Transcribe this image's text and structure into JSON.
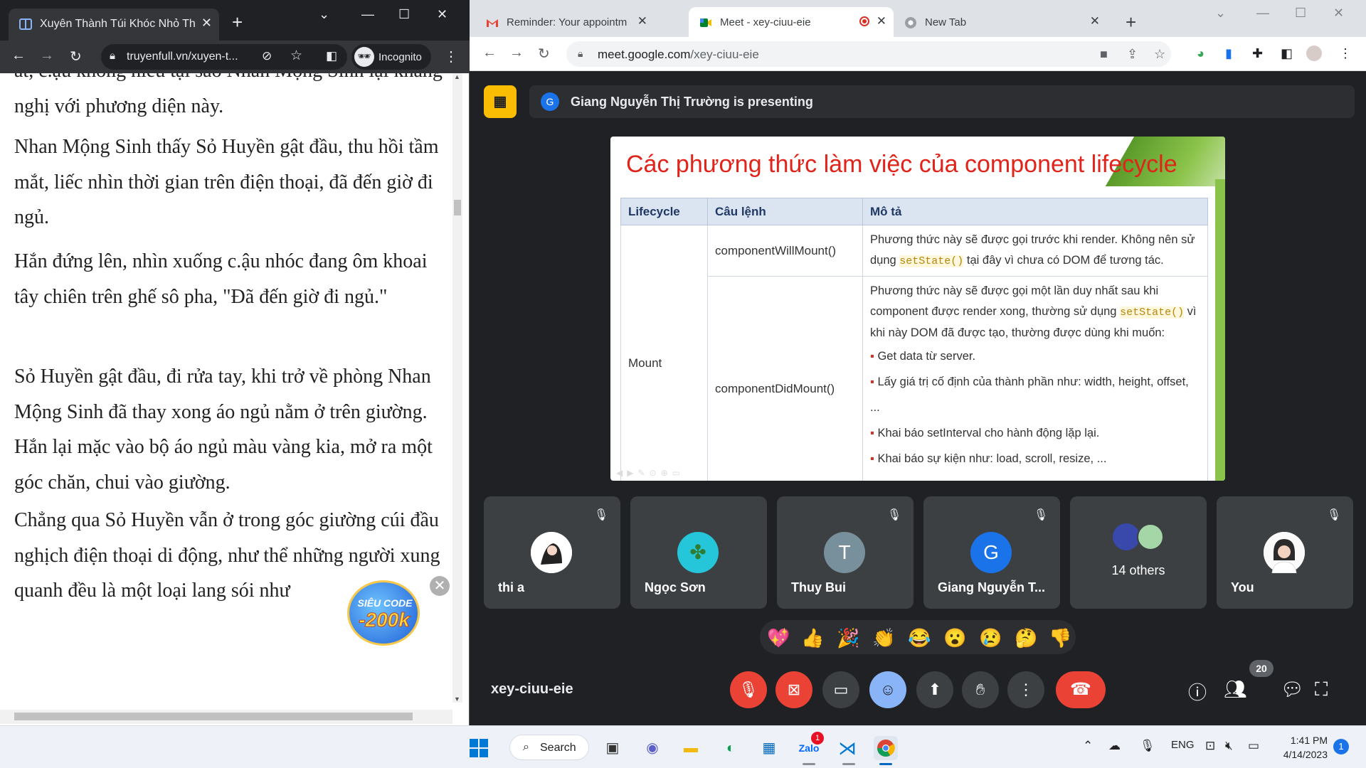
{
  "left_window": {
    "tab_title": "Xuyên Thành Túi Khóc Nhỏ Thích",
    "url": "truyenfull.vn/xuyen-t...",
    "incognito_label": "Incognito",
    "paragraphs": [
      "at, c.ậu không hiểu tại sao Nhan Mộng Sinh lại kháng nghị với phương diện này.",
      "Nhan Mộng Sinh thấy Sỏ Huyền gật đầu, thu hồi tầm mắt, liếc nhìn thời gian trên điện thoại, đã đến giờ đi ngủ.",
      "Hắn đứng lên, nhìn xuống c.ậu nhóc đang ôm khoai tây chiên trên ghế sô pha, \"Đã đến giờ đi ngủ.\"",
      "Sỏ Huyền gật đầu, đi rửa tay, khi trở về phòng Nhan Mộng Sinh đã thay xong áo ngủ nằm ở trên giường. Hắn lại mặc vào bộ áo ngủ màu vàng kia, mở ra một góc chăn, chui vào giường.",
      "Chẳng qua Sỏ Huyền vẫn ở trong góc giường cúi đầu nghịch điện thoại di động, như thể những người xung quanh đều là một loại lang sói như"
    ],
    "promo": {
      "line1": "SIÊU CODE",
      "line2": "-200k"
    }
  },
  "right_window": {
    "tabs": [
      {
        "title": "Reminder: Your appointment is o",
        "icon": "gmail-icon"
      },
      {
        "title": "Meet - xey-ciuu-eie",
        "icon": "meet-icon"
      },
      {
        "title": "New Tab",
        "icon": "chrome-icon"
      }
    ],
    "url_host": "meet.google.com",
    "url_path": "/xey-ciuu-eie",
    "presenting_avatar": "G",
    "presenting_text": "Giang Nguyễn Thị Trường is presenting",
    "slide": {
      "title": "Các phương thức làm việc của component lifecycle",
      "headers": [
        "Lifecycle",
        "Câu lệnh",
        "Mô tả"
      ],
      "group": "Mount",
      "rows": [
        {
          "method": "componentWillMount()",
          "desc_a": "Phương thức này sẽ được gọi trước khi render. Không nên sử dụng ",
          "code": "setState()",
          "desc_b": " tại đây vì chưa có DOM để tương tác."
        },
        {
          "method": "componentDidMount()",
          "desc_a": "Phương thức này sẽ được gọi một lần duy nhất sau khi component được render xong, thường sử dụng ",
          "code": "setState()",
          "desc_b": " vì khi này DOM đã được tạo, thường được dùng khi muốn:",
          "bullets": [
            "Get data từ server.",
            "Lấy giá trị cố định của thành phần như: width, height, offset, ...",
            "Khai báo setInterval cho hành động lặp lại.",
            "Khai báo sự kiện như: load, scroll, resize, ...",
            "..."
          ]
        }
      ]
    },
    "participants": [
      {
        "name": "thi a",
        "initial": "",
        "color": "#ffffff",
        "muted": true
      },
      {
        "name": "Ngọc Sơn",
        "initial": "✤",
        "color": "#26c6da",
        "muted": false
      },
      {
        "name": "Thuy Bui",
        "initial": "T",
        "color": "#78909c",
        "muted": true
      },
      {
        "name": "Giang Nguyễn T...",
        "initial": "G",
        "color": "#1a73e8",
        "muted": true
      },
      {
        "name": "14 others",
        "initial": "",
        "color": "#3c4043",
        "muted": false
      },
      {
        "name": "You",
        "initial": "",
        "color": "#ffffff",
        "muted": true
      }
    ],
    "reactions": [
      "💖",
      "👍",
      "🎉",
      "👏",
      "😂",
      "😮",
      "😢",
      "🤔",
      "👎"
    ],
    "meeting_code": "xey-ciuu-eie",
    "people_count": "20"
  },
  "taskbar": {
    "search_label": "Search",
    "lang": "ENG",
    "time": "1:41 PM",
    "date": "4/14/2023",
    "notifications": "1",
    "zalo_badge": "1"
  }
}
